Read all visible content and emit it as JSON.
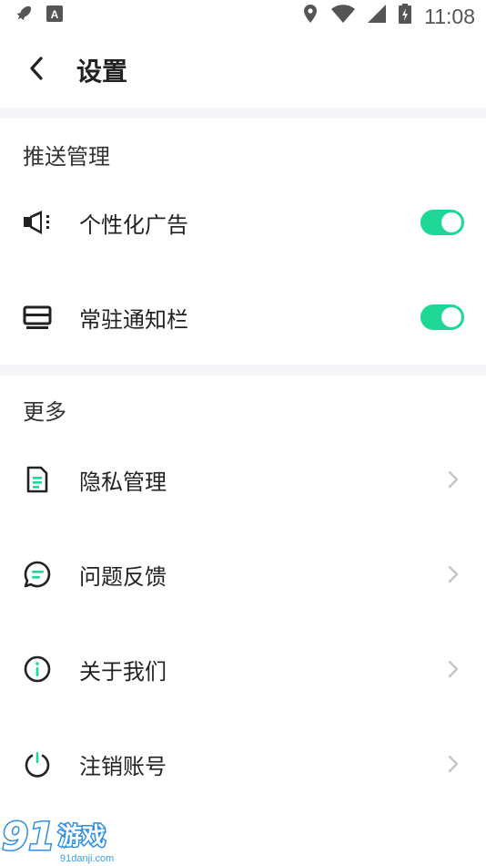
{
  "status_bar": {
    "time": "11:08",
    "icons_left": [
      "rocket-icon",
      "font-a-icon"
    ],
    "icons_right": [
      "location-icon",
      "wifi-icon",
      "signal-icon",
      "battery-icon"
    ]
  },
  "header": {
    "title": "设置",
    "back_icon": "chevron-left-icon"
  },
  "sections": [
    {
      "title": "推送管理",
      "items": [
        {
          "label": "个性化广告",
          "icon": "megaphone-icon",
          "control": "toggle",
          "on": true
        },
        {
          "label": "常驻通知栏",
          "icon": "wallet-icon",
          "control": "toggle",
          "on": true
        }
      ]
    },
    {
      "title": "更多",
      "items": [
        {
          "label": "隐私管理",
          "icon": "document-icon",
          "control": "chevron"
        },
        {
          "label": "问题反馈",
          "icon": "chat-bubble-icon",
          "control": "chevron"
        },
        {
          "label": "关于我们",
          "icon": "info-icon",
          "control": "chevron"
        },
        {
          "label": "注销账号",
          "icon": "power-icon",
          "control": "chevron"
        }
      ]
    }
  ],
  "watermark": {
    "brand": "91游戏",
    "url": "91danji.com"
  },
  "colors": {
    "accent": "#1ed796",
    "icon_dark": "#222222",
    "band": "#f5f5f7",
    "chevron": "#c4c4c4"
  }
}
